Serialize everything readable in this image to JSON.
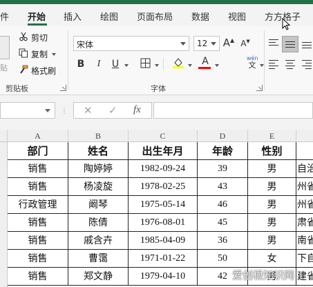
{
  "tabs": [
    "件",
    "开始",
    "插入",
    "绘图",
    "页面布局",
    "数据",
    "视图",
    "方方格子"
  ],
  "ribbon": {
    "cut": "剪切",
    "copy": "复制",
    "format_painter": "格式刷",
    "paste_partial": "贴",
    "clipboard_group": "剪贴板",
    "font_group": "字体",
    "font_name": "宋体",
    "font_size": "12",
    "increase_font": "A",
    "decrease_font": "A",
    "bold": "B",
    "italic": "I",
    "underline": "U",
    "font_color_letter": "A",
    "phonetic_top": "wén",
    "phonetic_bottom": "文",
    "fill_color": "#FFFF00",
    "font_color": "#FF0000",
    "accent": "#217346"
  },
  "formula_bar": {
    "name_box": "",
    "cancel": "✕",
    "enter": "✓",
    "fx": "fx",
    "value": ""
  },
  "columns": [
    "A",
    "B",
    "C",
    "D",
    "E"
  ],
  "table": {
    "headers": [
      "部门",
      "姓名",
      "出生年月",
      "年龄",
      "性别"
    ],
    "rows": [
      [
        "销售",
        "陶婷婷",
        "1982-09-24",
        "39",
        "男",
        "自治"
      ],
      [
        "销售",
        "杨凌旋",
        "1978-02-25",
        "43",
        "男",
        "州省"
      ],
      [
        "行政管理",
        "阚琴",
        "1975-05-14",
        "46",
        "男",
        "州省"
      ],
      [
        "销售",
        "陈倩",
        "1976-08-01",
        "45",
        "男",
        "肃省"
      ],
      [
        "销售",
        "戚含卉",
        "1985-04-09",
        "36",
        "男",
        "南省"
      ],
      [
        "销售",
        "曹霭",
        "1971-01-22",
        "50",
        "女",
        "下自"
      ],
      [
        "销售",
        "郑文静",
        "1979-04-10",
        "42",
        "男",
        "建省"
      ]
    ]
  },
  "watermark": "爱创根知识网"
}
